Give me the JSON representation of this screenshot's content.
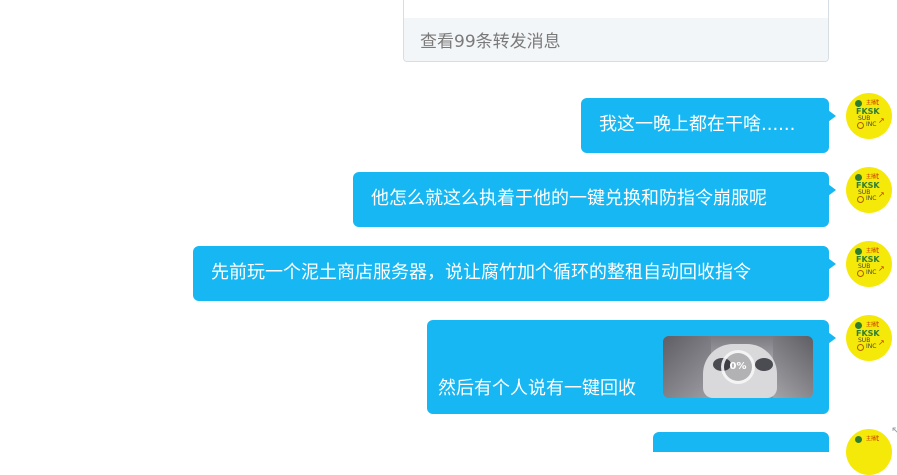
{
  "forward_card": {
    "footer_text": "查看99条转发消息"
  },
  "messages": [
    {
      "text": "我这一晚上都在干啥......"
    },
    {
      "text": "他怎么就这么执着于他的一键兑换和防指令崩服呢"
    },
    {
      "text": "先前玩一个泥土商店服务器，说让腐竹加个循环的整租自动回收指令"
    },
    {
      "text": "然后有个人说有一键回收",
      "image_progress": "0%"
    },
    {
      "text": ""
    }
  ],
  "avatar": {
    "line1": "FKSK",
    "line2": "SUB",
    "line3": "INC",
    "small_text": "主播",
    "top_mark": "t",
    "arrow": "↗"
  },
  "colors": {
    "bubble": "#16b7f2",
    "avatar": "#f5e90a",
    "forward_footer": "#f3f6f8"
  }
}
